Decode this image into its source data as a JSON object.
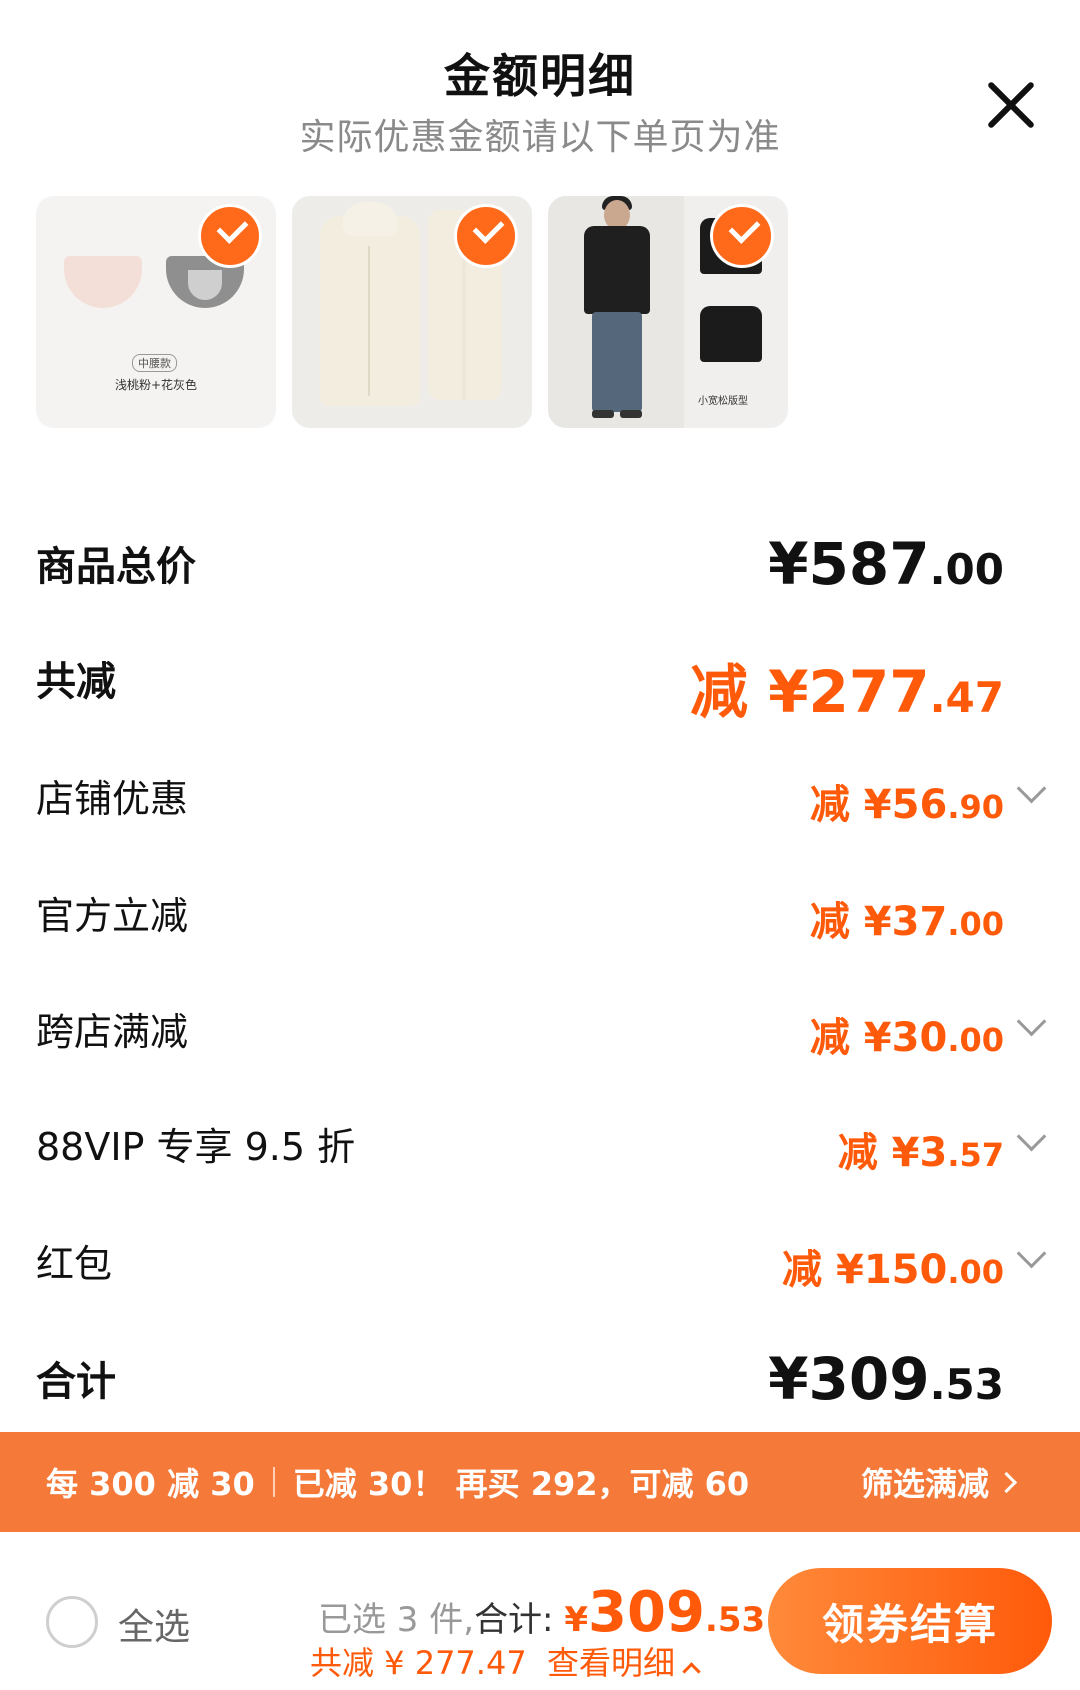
{
  "header": {
    "title": "金额明细",
    "subtitle": "实际优惠金额请以下单页为准"
  },
  "products": [
    {
      "tag": "中腰款",
      "caption": "浅桃粉+花灰色",
      "checked": true
    },
    {
      "checked": true
    },
    {
      "caption": "小宽松版型",
      "checked": true
    }
  ],
  "rows": {
    "total_price": {
      "label": "商品总价",
      "currency": "¥",
      "int": "587",
      "dec": ".00"
    },
    "total_discount": {
      "label": "共减",
      "prefix": "减",
      "currency": "¥",
      "int": "277",
      "dec": ".47"
    },
    "shop_discount": {
      "label": "店铺优惠",
      "prefix": "减",
      "currency": "¥",
      "int": "56",
      "dec": ".90"
    },
    "official_discount": {
      "label": "官方立减",
      "prefix": "减",
      "currency": "¥",
      "int": "37",
      "dec": ".00"
    },
    "cross_store": {
      "label": "跨店满减",
      "prefix": "减",
      "currency": "¥",
      "int": "30",
      "dec": ".00"
    },
    "vip": {
      "label": "88VIP 专享 9.5 折",
      "prefix": "减",
      "currency": "¥",
      "int": "3",
      "dec": ".57"
    },
    "red_packet": {
      "label": "红包",
      "prefix": "减",
      "currency": "¥",
      "int": "150",
      "dec": ".00"
    },
    "grand_total": {
      "label": "合计",
      "currency": "¥",
      "int": "309",
      "dec": ".53"
    }
  },
  "promo": {
    "rule": "每 300 减 30",
    "status": "已减 30！ 再买 292，可减 60",
    "filter_label": "筛选满减"
  },
  "bottom": {
    "select_all": "全选",
    "selected_text": "已选 3 件,",
    "total_label": "合计:",
    "currency": "¥",
    "int": "309",
    "dec": ".53",
    "discount_text": "共减 ¥ 277.47",
    "detail_link": "查看明细",
    "checkout_label": "领券结算"
  },
  "colors": {
    "accent": "#ff5a0a",
    "promo_bg": "#f57a3a"
  }
}
